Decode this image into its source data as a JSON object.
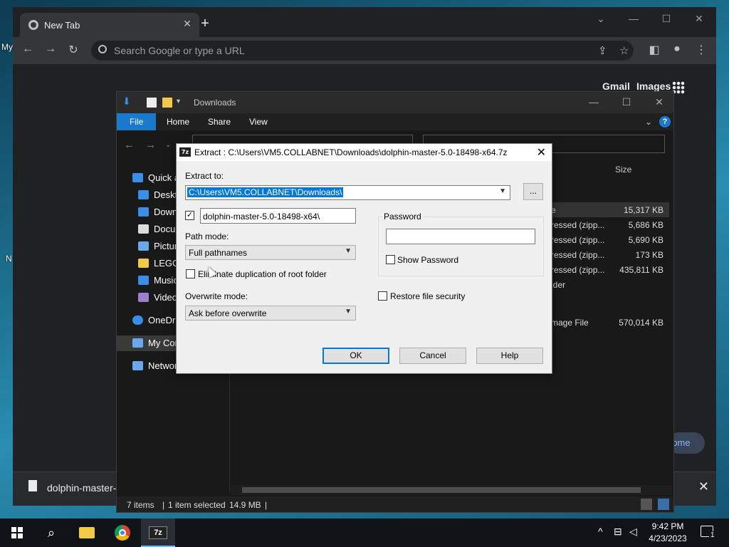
{
  "desktop": {
    "label_my": "My",
    "label_n": "N"
  },
  "chrome": {
    "tab_title": "New Tab",
    "omnibox_placeholder": "Search Google or type a URL",
    "ntp_links": [
      "Gmail",
      "Images"
    ],
    "download_name": "dolphin-master-5",
    "continue_text": "rome"
  },
  "explorer": {
    "title": "Downloads",
    "ribbon_tabs": [
      "File",
      "Home",
      "Share",
      "View"
    ],
    "nav_items": [
      {
        "label": "Quick a",
        "icon": "star-icon",
        "color": "#3b8ee8"
      },
      {
        "label": "Deskto",
        "icon": "desktop-icon",
        "color": "#3b8ee8"
      },
      {
        "label": "Down",
        "icon": "download-icon",
        "color": "#3b8ee8"
      },
      {
        "label": "Docu",
        "icon": "document-icon",
        "color": "#dcdcdc"
      },
      {
        "label": "Pictur",
        "icon": "picture-icon",
        "color": "#6aa9e9"
      },
      {
        "label": "LEGO",
        "icon": "folder-icon",
        "color": "#f3c94a"
      },
      {
        "label": "Music",
        "icon": "music-icon",
        "color": "#3b8ee8"
      },
      {
        "label": "Video",
        "icon": "video-icon",
        "color": "#9b7fd1"
      },
      {
        "label": "OneDriv",
        "icon": "cloud-icon",
        "color": "#3b8ee8"
      },
      {
        "label": "My Cor",
        "icon": "computer-icon",
        "color": "#6aa9e9"
      },
      {
        "label": "Networ",
        "icon": "network-icon",
        "color": "#6aa9e9"
      }
    ],
    "column_size": "Size",
    "rows": [
      {
        "type": "e",
        "size": "15,317 KB"
      },
      {
        "type": "ressed (zipp...",
        "size": "5,686 KB"
      },
      {
        "type": "ressed (zipp...",
        "size": "5,690 KB"
      },
      {
        "type": "ressed (zipp...",
        "size": "173 KB"
      },
      {
        "type": "ressed (zipp...",
        "size": "435,811 KB"
      },
      {
        "type": "lder",
        "size": ""
      },
      {
        "type": "mage File",
        "size": "570,014 KB"
      }
    ],
    "status": {
      "items": "7 items",
      "selected": "1 item selected",
      "size": "14.9 MB"
    }
  },
  "dialog": {
    "title": "Extract : C:\\Users\\VM5.COLLABNET\\Downloads\\dolphin-master-5.0-18498-x64.7z",
    "extract_to_label": "Extract to:",
    "extract_to_value": "C:\\Users\\VM5.COLLABNET\\Downloads\\",
    "browse_label": "...",
    "subfolder_value": "dolphin-master-5.0-18498-x64\\",
    "subfolder_checked": true,
    "path_mode_label": "Path mode:",
    "path_mode_value": "Full pathnames",
    "eliminate_label": "Eliminate duplication of root folder",
    "overwrite_label": "Overwrite mode:",
    "overwrite_value": "Ask before overwrite",
    "password_group": "Password",
    "password_value": "",
    "show_password_label": "Show Password",
    "restore_security_label": "Restore file security",
    "ok_label": "OK",
    "cancel_label": "Cancel",
    "help_label": "Help"
  },
  "taskbar": {
    "time": "9:42 PM",
    "date": "4/23/2023",
    "notification_count": "1"
  }
}
